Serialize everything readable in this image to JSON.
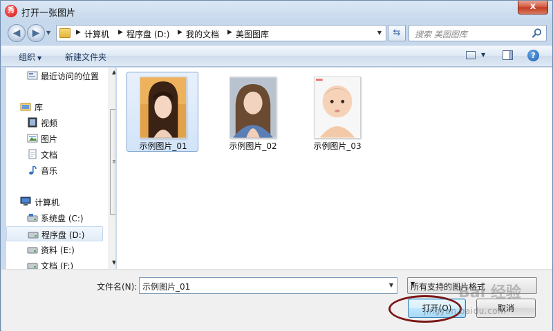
{
  "window": {
    "title": "打开一张图片",
    "close_label": "x"
  },
  "nav": {
    "breadcrumbs": [
      "计算机",
      "程序盘 (D:)",
      "我的文档",
      "美图图库"
    ],
    "search_placeholder": "搜索 美图图库"
  },
  "toolbar": {
    "organize_label": "组织",
    "new_folder_label": "新建文件夹"
  },
  "sidebar": {
    "items": [
      {
        "label": "最近访问的位置",
        "icon": "recent-places-icon"
      },
      {
        "label": "库",
        "icon": "library-icon"
      },
      {
        "label": "视频",
        "icon": "video-icon"
      },
      {
        "label": "图片",
        "icon": "picture-icon"
      },
      {
        "label": "文档",
        "icon": "document-icon"
      },
      {
        "label": "音乐",
        "icon": "music-icon"
      },
      {
        "label": "计算机",
        "icon": "computer-icon"
      },
      {
        "label": "系统盘 (C:)",
        "icon": "drive-icon"
      },
      {
        "label": "程序盘 (D:)",
        "icon": "drive-icon"
      },
      {
        "label": "资料 (E:)",
        "icon": "drive-icon"
      },
      {
        "label": "文档 (F:)",
        "icon": "drive-icon"
      }
    ]
  },
  "files": [
    {
      "name": "示例图片_01",
      "selected": true
    },
    {
      "name": "示例图片_02",
      "selected": false
    },
    {
      "name": "示例图片_03",
      "selected": false
    }
  ],
  "bottom": {
    "filename_label": "文件名(N):",
    "filename_value": "示例图片_01",
    "filetype_value": "所有支持的图片格式",
    "open_label": "打开(O)",
    "cancel_label": "取消"
  },
  "watermark": {
    "text": "Bai 经验",
    "sub": "jingyan.baidu.com"
  },
  "colors": {
    "accent": "#3c7fb1",
    "selection": "#d2e4f9",
    "annotation": "#7a1616"
  }
}
